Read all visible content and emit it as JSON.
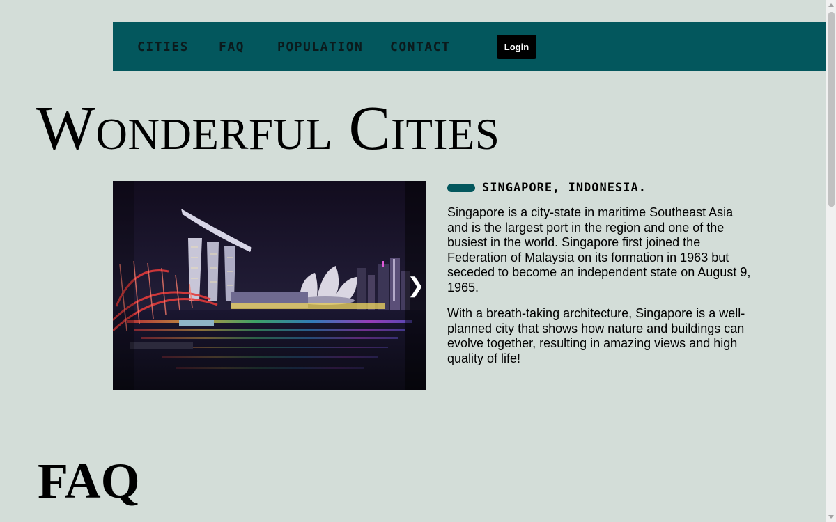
{
  "nav": {
    "links": [
      "CITIES",
      "FAQ",
      "POPULATION",
      "CONTACT"
    ],
    "login_label": "Login"
  },
  "page_title": "Wonderful Cities",
  "carousel": {
    "next_glyph": "❯",
    "image_alt": "Singapore Marina Bay skyline at night"
  },
  "city": {
    "name": "SINGAPORE, INDONESIA.",
    "paragraphs": [
      "Singapore is a city-state in maritime Southeast Asia and is the largest port in the region and one of the busiest in the world. Singapore first joined the Federation of Malaysia on its formation in 1963 but seceded to become an independent state on August 9, 1965.",
      "With a breath-taking architecture, Singapore is a well-planned city that shows how nature and buildings can evolve together, resulting in amazing views and high quality of life!"
    ]
  },
  "faq_title": "FAQ",
  "colors": {
    "background": "#d3ddd8",
    "nav_bg": "#03575d",
    "accent": "#03575d",
    "button_bg": "#000000"
  },
  "icons": {
    "carousel_next": "chevron-right-icon",
    "heading_marker": "pill-marker-icon"
  }
}
